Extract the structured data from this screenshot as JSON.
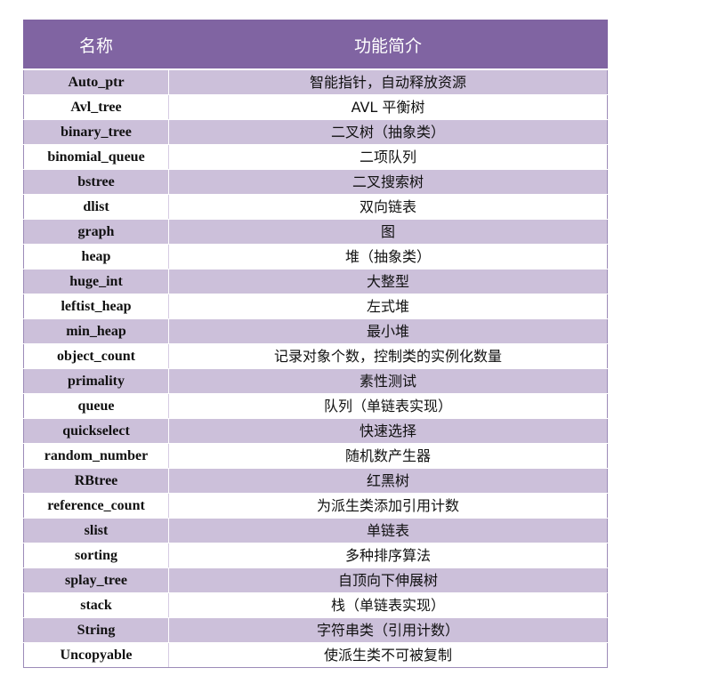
{
  "table": {
    "headers": [
      "名称",
      "功能简介"
    ],
    "rows": [
      {
        "name": "Auto_ptr",
        "desc": "智能指针，自动释放资源"
      },
      {
        "name": "Avl_tree",
        "desc": "AVL 平衡树"
      },
      {
        "name": "binary_tree",
        "desc": "二叉树（抽象类）"
      },
      {
        "name": "binomial_queue",
        "desc": "二项队列"
      },
      {
        "name": "bstree",
        "desc": "二叉搜索树"
      },
      {
        "name": "dlist",
        "desc": "双向链表"
      },
      {
        "name": "graph",
        "desc": "图"
      },
      {
        "name": "heap",
        "desc": "堆（抽象类）"
      },
      {
        "name": "huge_int",
        "desc": "大整型"
      },
      {
        "name": "leftist_heap",
        "desc": "左式堆"
      },
      {
        "name": "min_heap",
        "desc": "最小堆"
      },
      {
        "name": "object_count",
        "desc": "记录对象个数，控制类的实例化数量"
      },
      {
        "name": "primality",
        "desc": "素性测试"
      },
      {
        "name": "queue",
        "desc": "队列（单链表实现）"
      },
      {
        "name": "quickselect",
        "desc": "快速选择"
      },
      {
        "name": "random_number",
        "desc": "随机数产生器"
      },
      {
        "name": "RBtree",
        "desc": "红黑树"
      },
      {
        "name": "reference_count",
        "desc": "为派生类添加引用计数"
      },
      {
        "name": "slist",
        "desc": "单链表"
      },
      {
        "name": "sorting",
        "desc": "多种排序算法"
      },
      {
        "name": "splay_tree",
        "desc": "自顶向下伸展树"
      },
      {
        "name": "stack",
        "desc": "栈（单链表实现）"
      },
      {
        "name": "String",
        "desc": "字符串类（引用计数）"
      },
      {
        "name": "Uncopyable",
        "desc": "使派生类不可被复制"
      }
    ]
  },
  "colors": {
    "header_bg": "#8064a2",
    "band_bg": "#ccc0da",
    "plain_bg": "#ffffff"
  }
}
